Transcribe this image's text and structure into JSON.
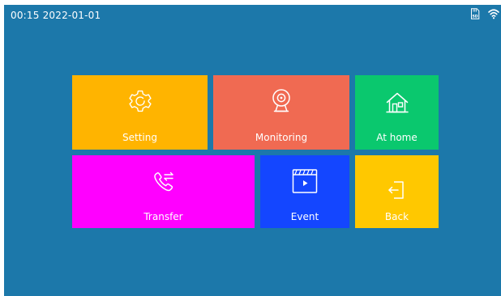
{
  "status_bar": {
    "datetime": "00:15 2022-01-01",
    "icons": [
      "sd-card-icon",
      "wifi-icon"
    ]
  },
  "colors": {
    "background": "#1c78aa",
    "setting": "#ffb400",
    "monitoring": "#f06a52",
    "at_home": "#0ac86e",
    "transfer": "#ff00ff",
    "event": "#1446ff",
    "back": "#ffc800"
  },
  "tiles": {
    "setting": {
      "label": "Setting",
      "icon": "gear-icon"
    },
    "monitoring": {
      "label": "Monitoring",
      "icon": "camera-icon"
    },
    "at_home": {
      "label": "At home",
      "icon": "house-icon"
    },
    "transfer": {
      "label": "Transfer",
      "icon": "phone-transfer-icon"
    },
    "event": {
      "label": "Event",
      "icon": "video-clip-icon"
    },
    "back": {
      "label": "Back",
      "icon": "exit-icon"
    }
  }
}
